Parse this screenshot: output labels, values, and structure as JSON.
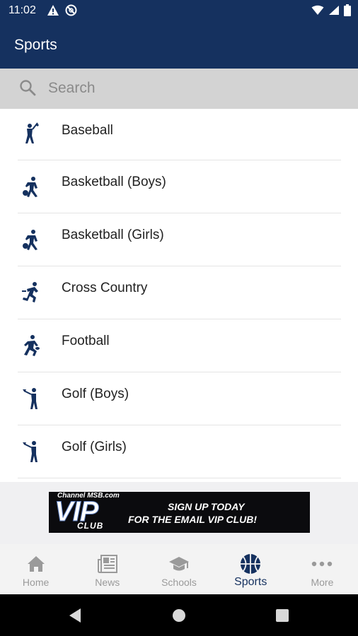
{
  "status_bar": {
    "time": "11:02",
    "left_icons": [
      "warning-icon",
      "no-sync-icon"
    ],
    "right_icons": [
      "wifi-icon",
      "signal-icon",
      "battery-icon"
    ]
  },
  "app_bar": {
    "title": "Sports"
  },
  "search": {
    "placeholder": "Search"
  },
  "sports": [
    {
      "label": "Baseball",
      "icon": "baseball-icon"
    },
    {
      "label": "Basketball (Boys)",
      "icon": "basketball-icon"
    },
    {
      "label": "Basketball (Girls)",
      "icon": "basketball-icon"
    },
    {
      "label": "Cross Country",
      "icon": "running-icon"
    },
    {
      "label": "Football",
      "icon": "football-icon"
    },
    {
      "label": "Golf (Boys)",
      "icon": "golf-icon"
    },
    {
      "label": "Golf (Girls)",
      "icon": "golf-icon"
    }
  ],
  "ad": {
    "brand": "Channel MSB.com",
    "title": "VIP",
    "subtitle": "CLUB",
    "line1": "SIGN UP TODAY",
    "line2": "FOR THE EMAIL VIP CLUB!"
  },
  "bottom_nav": [
    {
      "label": "Home",
      "icon": "home-icon",
      "active": false
    },
    {
      "label": "News",
      "icon": "newspaper-icon",
      "active": false
    },
    {
      "label": "Schools",
      "icon": "graduation-cap-icon",
      "active": false
    },
    {
      "label": "Sports",
      "icon": "basketball-ball-icon",
      "active": true
    },
    {
      "label": "More",
      "icon": "more-dots-icon",
      "active": false
    }
  ],
  "colors": {
    "primary": "#15315f",
    "search_bg": "#d3d3d3",
    "nav_inactive": "#9a9a9a"
  }
}
